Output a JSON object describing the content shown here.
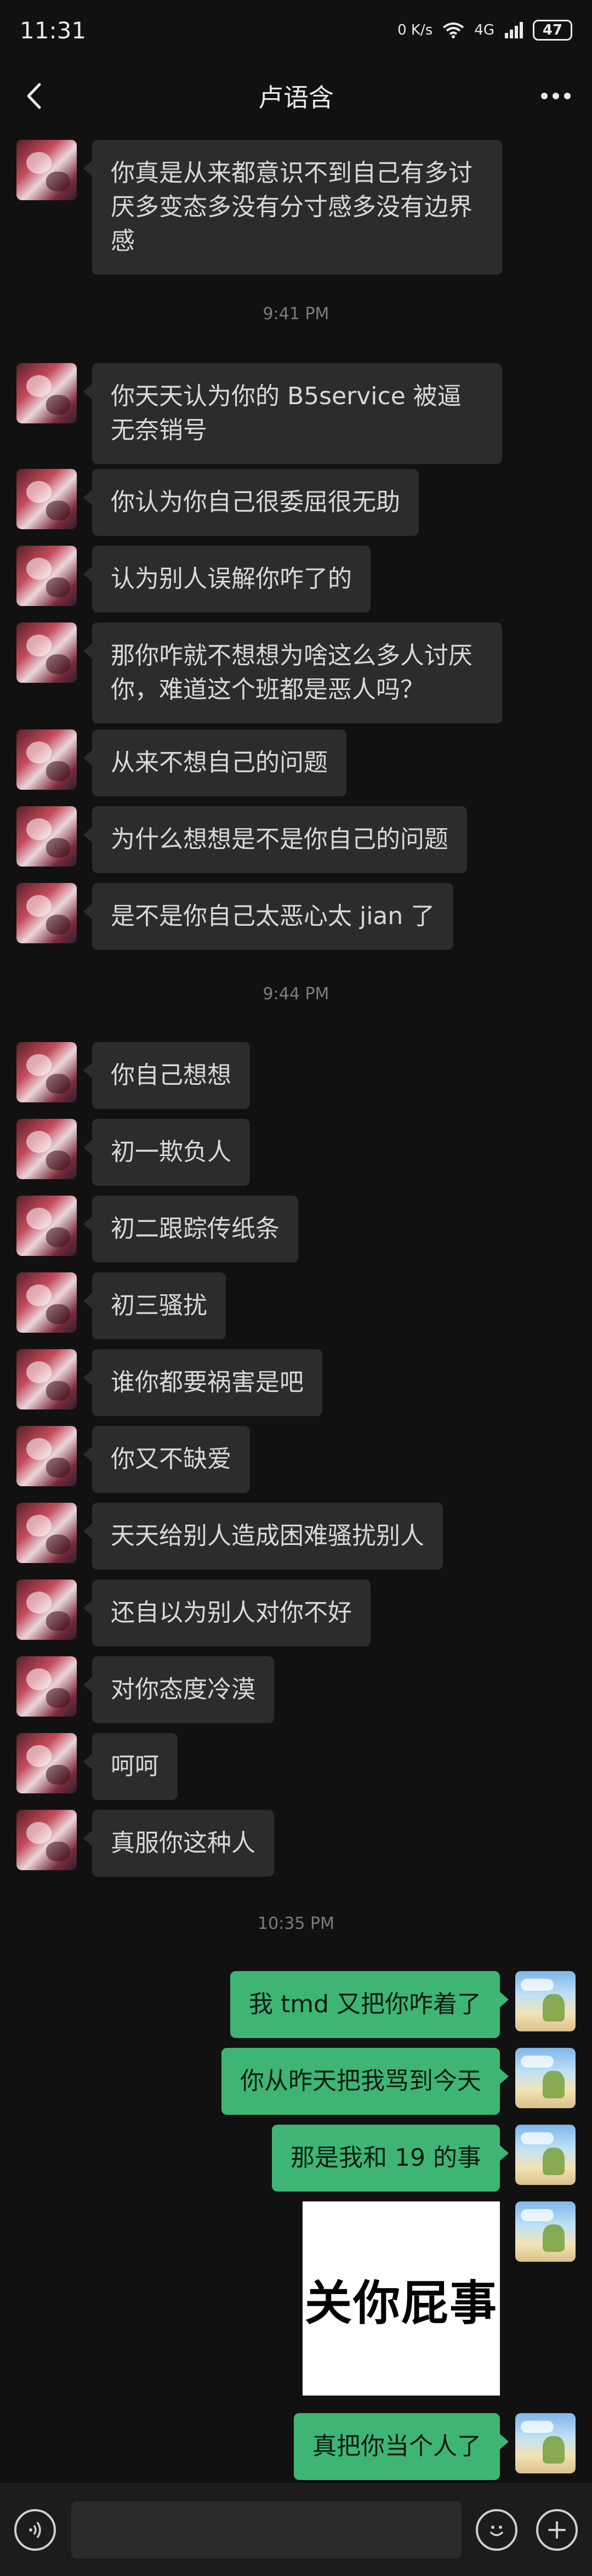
{
  "status": {
    "time": "11:31",
    "net_speed": "0 K/s",
    "signal": "4G",
    "battery": "47"
  },
  "header": {
    "title": "卢语含"
  },
  "timestamps": [
    "9:41 PM",
    "9:44 PM",
    "10:35 PM"
  ],
  "messages": [
    {
      "side": "left",
      "text": "你真是从来都意识不到自己有多讨厌多变态多没有分寸感多没有边界感"
    },
    {
      "side": "left",
      "text": "你天天认为你的 B5service 被逼无奈销号"
    },
    {
      "side": "left",
      "text": "你认为你自己很委屈很无助"
    },
    {
      "side": "left",
      "text": "认为别人误解你咋了的"
    },
    {
      "side": "left",
      "text": "那你咋就不想想为啥这么多人讨厌你，难道这个班都是恶人吗？"
    },
    {
      "side": "left",
      "text": "从来不想自己的问题"
    },
    {
      "side": "left",
      "text": "为什么想想是不是你自己的问题"
    },
    {
      "side": "left",
      "text": "是不是你自己太恶心太 jian 了"
    },
    {
      "side": "left",
      "text": "你自己想想"
    },
    {
      "side": "left",
      "text": "初一欺负人"
    },
    {
      "side": "left",
      "text": "初二跟踪传纸条"
    },
    {
      "side": "left",
      "text": "初三骚扰"
    },
    {
      "side": "left",
      "text": "谁你都要祸害是吧"
    },
    {
      "side": "left",
      "text": "你又不缺爱"
    },
    {
      "side": "left",
      "text": "天天给别人造成困难骚扰别人"
    },
    {
      "side": "left",
      "text": "还自以为别人对你不好"
    },
    {
      "side": "left",
      "text": "对你态度冷漠"
    },
    {
      "side": "left",
      "text": "呵呵"
    },
    {
      "side": "left",
      "text": "真服你这种人"
    },
    {
      "side": "right",
      "text": "我 tmd 又把你咋着了"
    },
    {
      "side": "right",
      "text": "你从昨天把我骂到今天"
    },
    {
      "side": "right",
      "text": "那是我和 19 的事"
    },
    {
      "side": "right",
      "text": "关你屁事",
      "kind": "sticker"
    },
    {
      "side": "right",
      "text": "真把你当个人了"
    }
  ],
  "input": {
    "placeholder": ""
  },
  "icons": {
    "back": "back-arrow-icon",
    "more": "more-dots-icon",
    "voice": "voice-icon",
    "emoji": "emoji-icon",
    "plus": "plus-icon"
  },
  "colors": {
    "background": "#111111",
    "bubble_left": "#2c2c2c",
    "bubble_right": "#3eb575"
  }
}
